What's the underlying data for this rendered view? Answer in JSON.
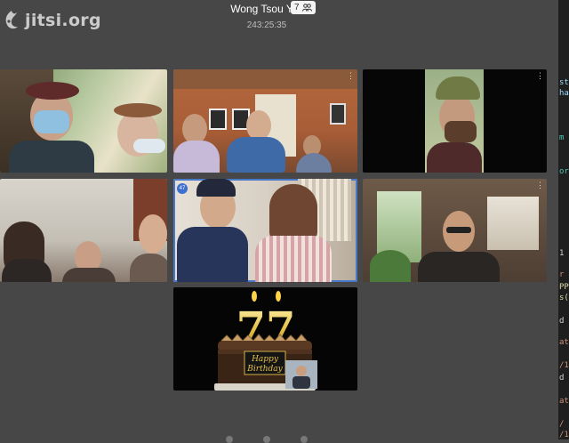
{
  "app": {
    "logo_text": "jitsi.org"
  },
  "meeting": {
    "title": "Wong Tsou Yiw",
    "timer": "243:25:35",
    "participant_count": "7"
  },
  "tiles": [
    {
      "name": "video-tile-1",
      "active": false
    },
    {
      "name": "video-tile-2",
      "active": false
    },
    {
      "name": "video-tile-3",
      "active": false
    },
    {
      "name": "video-tile-4",
      "active": false
    },
    {
      "name": "video-tile-5",
      "active": true,
      "badge": "47"
    },
    {
      "name": "video-tile-6",
      "active": false
    },
    {
      "name": "video-tile-7",
      "active": false
    }
  ],
  "cake": {
    "number": "77",
    "topper_line1": "Happy",
    "topper_line2": "Birthday"
  },
  "colors": {
    "background": "#474747",
    "active_border": "#4a78c8",
    "badge": "#3d6fd0"
  }
}
